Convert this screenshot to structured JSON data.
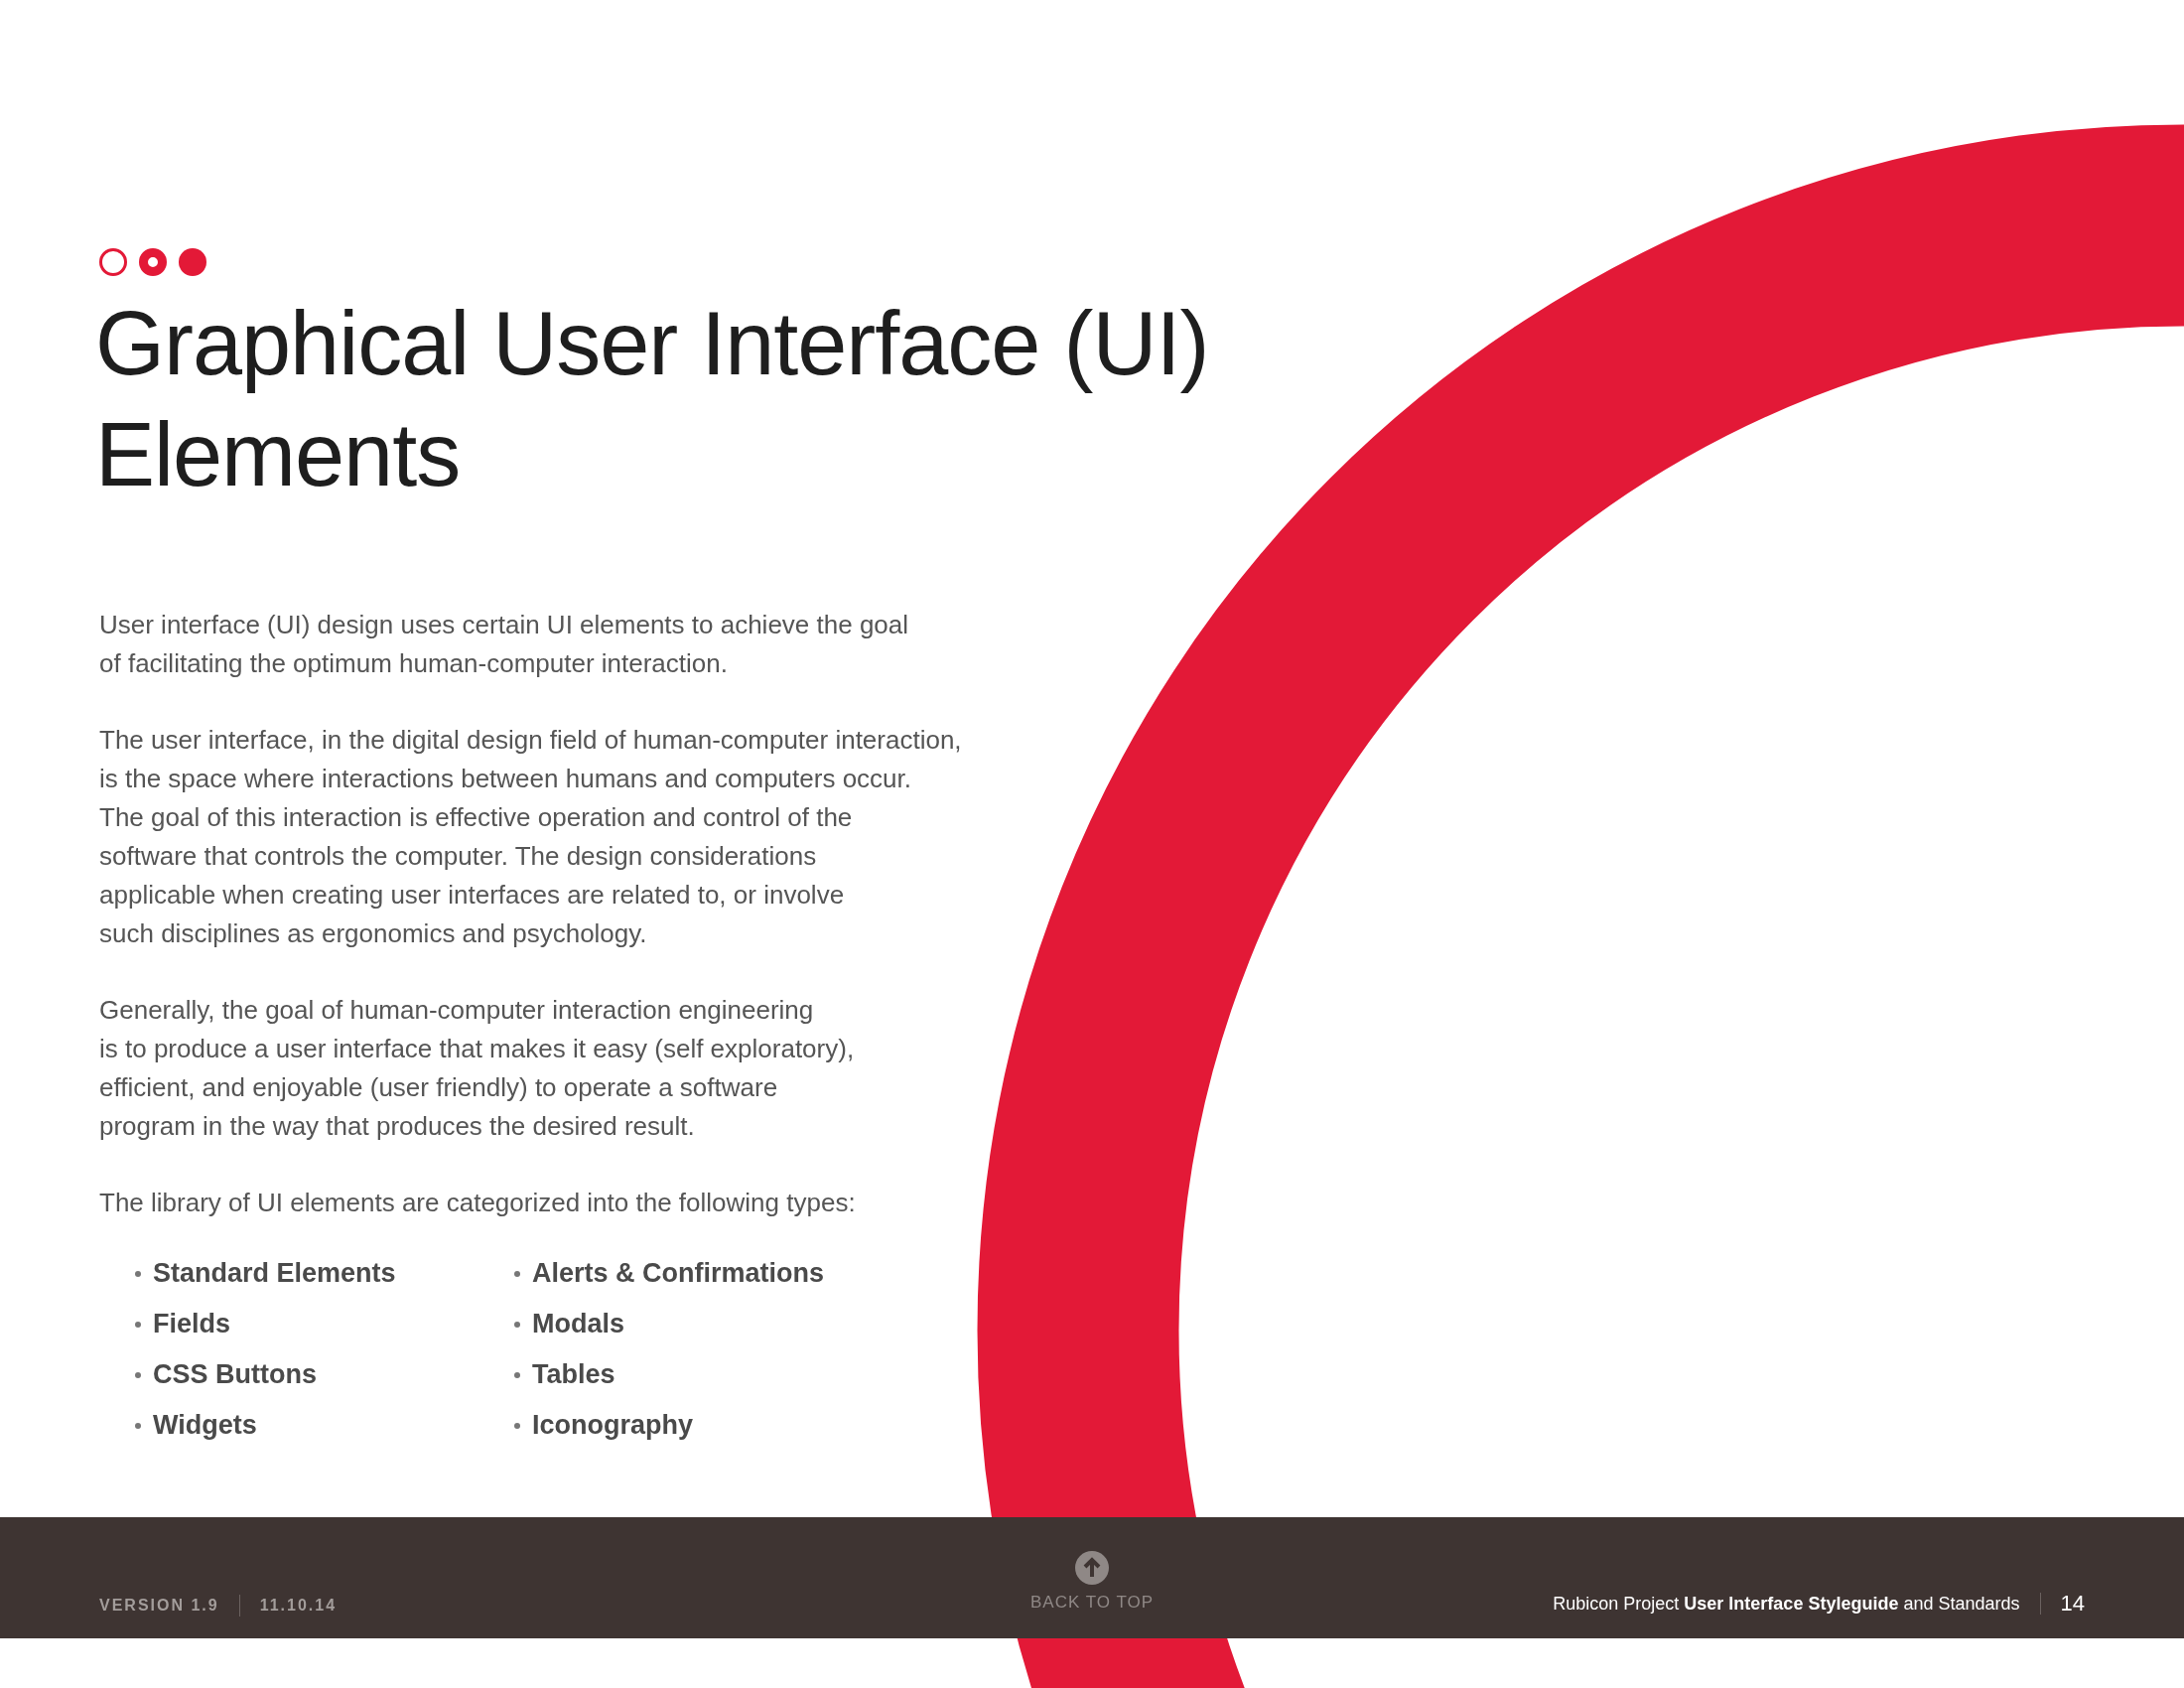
{
  "header": {
    "dots": [
      {
        "kind": "ring"
      },
      {
        "kind": "target"
      },
      {
        "kind": "solid"
      }
    ],
    "title_lines": [
      "Graphical User Interface (UI)",
      "Elements"
    ]
  },
  "paragraphs": [
    [
      "User interface (UI) design uses certain UI elements to achieve the goal",
      "of facilitating the optimum human-computer interaction."
    ],
    [
      "The user interface, in the digital design field of human-computer interaction,",
      "is the space where interactions between humans and computers occur.",
      "The goal of this interaction is effective operation and control of the",
      "software that controls the computer. The design considerations",
      "applicable when creating user interfaces are related to, or involve",
      "such disciplines as ergonomics and psychology."
    ],
    [
      "Generally, the goal of human-computer interaction engineering",
      "is to produce a user interface that makes it easy (self exploratory),",
      "efficient, and enjoyable (user friendly) to operate a software",
      "program in the way that produces the desired result."
    ],
    [
      "The library of UI elements are categorized into the following types:"
    ]
  ],
  "type_columns": [
    [
      "Standard Elements",
      "Fields",
      "CSS Buttons",
      "Widgets"
    ],
    [
      "Alerts & Confirmations",
      "Modals",
      "Tables",
      "Iconography"
    ]
  ],
  "footer": {
    "version": "VERSION 1.9",
    "date": "11.10.14",
    "back_to_top": "BACK TO TOP",
    "document_title": "Rubicon Project **User Interface Styleguide** and Standards",
    "page_number": "14"
  }
}
